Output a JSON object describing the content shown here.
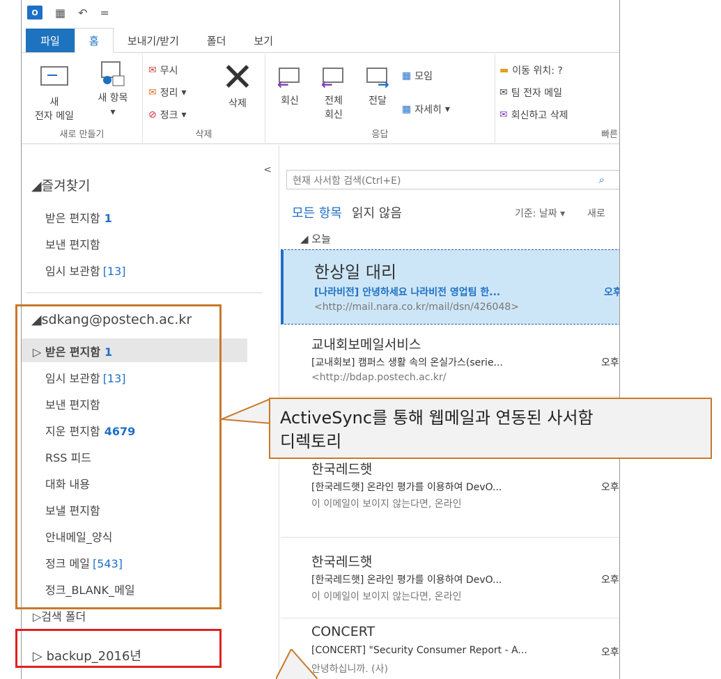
{
  "qat": {
    "logo": "O⊡",
    "undo": "↶",
    "sep": "="
  },
  "tabs": [
    "파일",
    "홈",
    "보내기/받기",
    "폴더",
    "보기"
  ],
  "ribbon": {
    "new_group": {
      "new_mail_line1": "새",
      "new_mail_line2": "전자 메일",
      "new_items": "새 항목",
      "label": "새로 만들기"
    },
    "delete_group": {
      "ignore": "무시",
      "cleanup": "정리",
      "junk": "정크",
      "delete": "삭제",
      "label": "삭제"
    },
    "respond_group": {
      "reply": "회신",
      "reply_all_line1": "전체",
      "reply_all_line2": "회신",
      "forward": "전달",
      "meeting": "모임",
      "more": "자세히",
      "label": "응답"
    },
    "quick_group": {
      "move_to": "이동 위치: ?",
      "team_email": "팀 전자 메일",
      "reply_delete": "회신하고 삭제",
      "label": "빠른"
    }
  },
  "folder_pane": {
    "collapse": "<",
    "favorites_head": "◢즐겨찾기",
    "favorites": [
      {
        "name": "받은 편지함",
        "count": "1",
        "count_style": "bold"
      },
      {
        "name": "보낸 편지함",
        "count": "",
        "count_style": ""
      },
      {
        "name": "임시 보관함",
        "count": "[13]",
        "count_style": "bracket"
      }
    ],
    "account_head": "◢sdkang@postech.ac.kr",
    "account_folders": [
      {
        "name": "▷ 받은 편지함",
        "count": "1",
        "count_style": "bold",
        "selected": true
      },
      {
        "name": "임시 보관함",
        "count": "[13]",
        "count_style": "bracket"
      },
      {
        "name": "보낸 편지함",
        "count": "",
        "count_style": ""
      },
      {
        "name": "지운 편지함",
        "count": "4679",
        "count_style": "bold"
      },
      {
        "name": "RSS 피드",
        "count": "",
        "count_style": ""
      },
      {
        "name": "대화 내용",
        "count": "",
        "count_style": ""
      },
      {
        "name": "보낼 편지함",
        "count": "",
        "count_style": ""
      },
      {
        "name": "안내메일_양식",
        "count": "",
        "count_style": ""
      },
      {
        "name": "정크 메일",
        "count": "[543]",
        "count_style": "bracket"
      },
      {
        "name": "정크_BLANK_메일",
        "count": "",
        "count_style": ""
      },
      {
        "name": "▷검색 폴더",
        "count": "",
        "count_style": ""
      }
    ],
    "backup": "▷ backup_2016년"
  },
  "mail_pane": {
    "search_placeholder": "현재 사서함 검색(Ctrl+E)",
    "filter_all": "모든 항목",
    "filter_unread": "읽지 않음",
    "sort": "기준: 날짜 ▾",
    "sort_new": "새로",
    "group_today": "◢ 오늘",
    "mails": [
      {
        "sender": "한상일 대리",
        "subject": "[나라비전] 안녕하세요 나라비전 영업팀 한...",
        "preview": "<http://mail.nara.co.kr/mail/dsn/426048>",
        "time": "오후"
      },
      {
        "sender": "교내회보메일서비스",
        "subject": "[교내회보] 캠퍼스 생활 속의 온실가스(serie...",
        "preview": "<http://bdap.postech.ac.kr/",
        "time": "오후"
      },
      {
        "sender": "한국레드햇",
        "subject": "[한국레드햇] 온라인 평가를 이용하여 DevO...",
        "preview": "이 이메일이 보이지 않는다면, 온라인",
        "time": "오후"
      },
      {
        "sender": "한국레드햇",
        "subject": "[한국레드햇] 온라인 평가를 이용하여 DevO...",
        "preview": "이 이메일이 보이지 않는다면, 온라인",
        "time": "오후"
      },
      {
        "sender": "CONCERT",
        "subject": "[CONCERT] \"Security Consumer Report - A...",
        "preview": "안녕하십니까. (사)",
        "time": "오후"
      }
    ]
  },
  "callout": {
    "line1": "ActiveSync를 통해 웹메일과 연동된 사서함",
    "line2": "디렉토리"
  },
  "colors": {
    "accent": "#1e6fc6",
    "file_tab": "#1e73be",
    "annotation_orange": "#c8782a",
    "annotation_red": "#e02020",
    "selected_mail": "#cde6f7"
  }
}
